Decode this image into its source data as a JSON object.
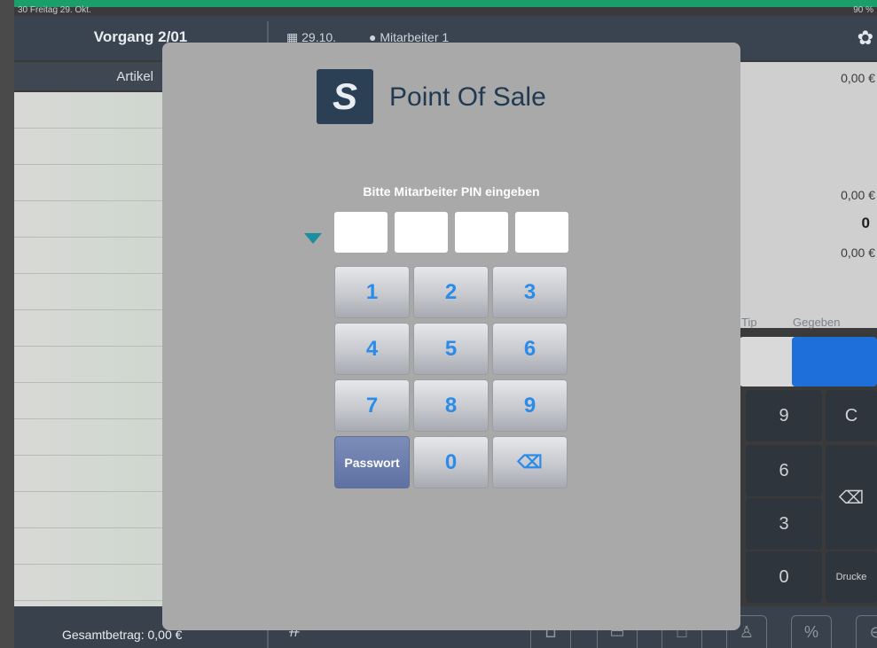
{
  "status": {
    "left_text": "30 Freitag 29. Okt.",
    "right_text": "90 %"
  },
  "topbar": {
    "title": "Vorgang 2/01",
    "date": "29.10.",
    "worker": "Mitarbeiter 1"
  },
  "list": {
    "column_header": "Artikel"
  },
  "right_pane": {
    "value_1": "0,00 €",
    "value_2": "0,00 €",
    "value_3": "0",
    "value_4": "0,00 €",
    "tip_label": "Tip",
    "given_label": "Gegeben"
  },
  "bg_keys": [
    "9",
    "C",
    "6",
    "3",
    "0",
    "Drucke"
  ],
  "bottom": {
    "total": "Gesamtbetrag: 0,00 €",
    "hash": "#"
  },
  "modal": {
    "app_title": "Point Of Sale",
    "prompt": "Bitte Mitarbeiter PIN eingeben",
    "pin_slots": [
      "",
      "",
      "",
      ""
    ],
    "keys": [
      "1",
      "2",
      "3",
      "4",
      "5",
      "6",
      "7",
      "8",
      "9"
    ],
    "password_label": "Passwort",
    "zero_label": "0",
    "backspace_label": "⌫"
  },
  "colors": {
    "accent": "#2b8be8",
    "brand": "#2b3f55",
    "green_bar": "#1a9e6a"
  }
}
